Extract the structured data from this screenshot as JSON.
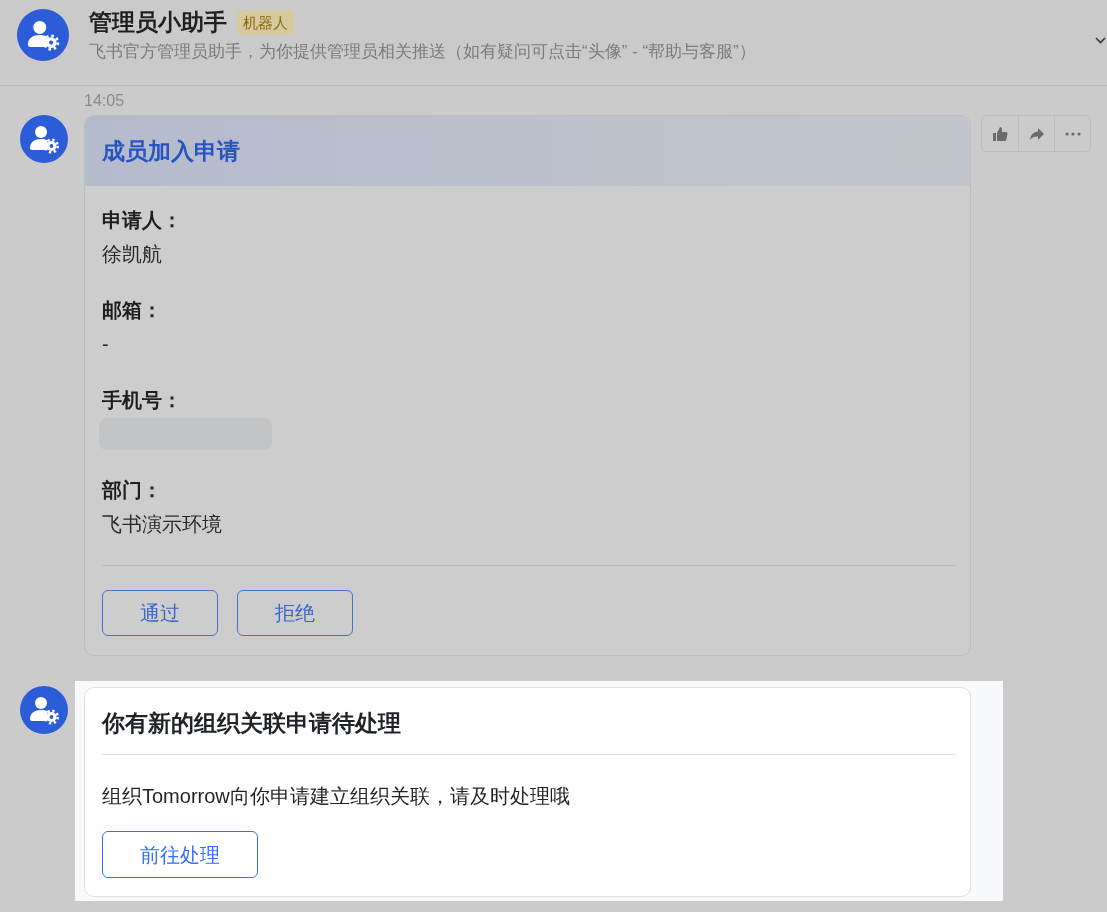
{
  "header": {
    "name": "管理员小助手",
    "badge": "机器人",
    "description": "飞书官方管理员助手，为你提供管理员相关推送（如有疑问可点击“头像” - “帮助与客服”）"
  },
  "messages": [
    {
      "time": "14:05",
      "kind": "form",
      "highlighted": false,
      "actions_shown": true,
      "title": "成员加入申请",
      "fields": [
        {
          "label": "申请人：",
          "value": "徐凯航",
          "redacted": false
        },
        {
          "label": "邮箱：",
          "value": "-",
          "redacted": false
        },
        {
          "label": "手机号：",
          "redacted": true
        },
        {
          "label": "部门：",
          "value": "飞书演示环境",
          "redacted": false
        }
      ],
      "buttons": [
        {
          "label": "通过"
        },
        {
          "label": "拒绝"
        }
      ]
    },
    {
      "kind": "notice",
      "highlighted": true,
      "actions_shown": false,
      "title": "你有新的组织关联申请待处理",
      "text": "组织Tomorrow向你申请建立组织关联，请及时处理哦",
      "buttons": [
        {
          "label": "前往处理"
        }
      ]
    }
  ]
}
